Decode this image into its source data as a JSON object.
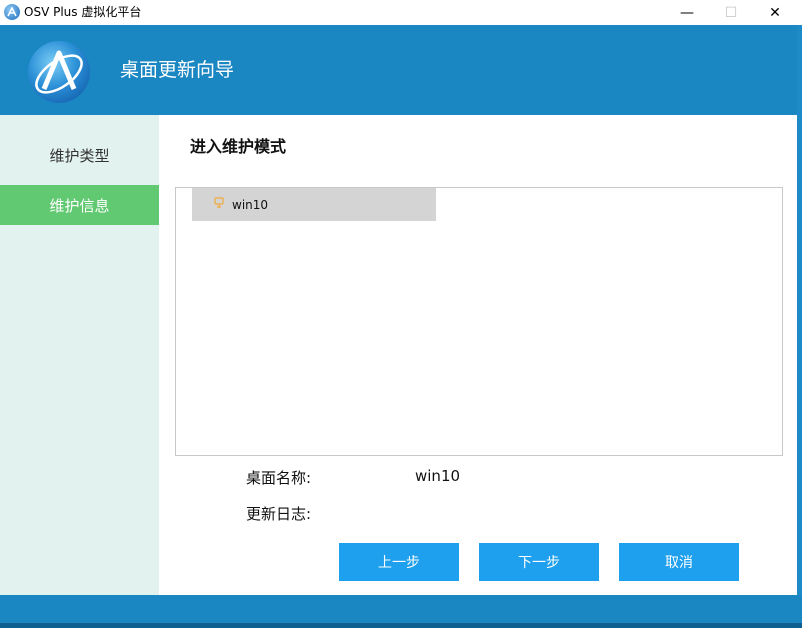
{
  "window": {
    "title": "OSV Plus 虚拟化平台",
    "controls": {
      "minimize": "—",
      "maximize": "☐",
      "close": "✕"
    }
  },
  "header": {
    "title": "桌面更新向导"
  },
  "sidebar": {
    "items": [
      {
        "label": "维护类型",
        "active": false
      },
      {
        "label": "维护信息",
        "active": true
      }
    ]
  },
  "main": {
    "section_title": "进入维护模式",
    "list": {
      "items": [
        {
          "icon": "vm-icon",
          "label": "win10",
          "selected": true
        }
      ]
    },
    "details": {
      "desktop_name_label": "桌面名称:",
      "desktop_name_value": "win10",
      "update_log_label": "更新日志:"
    },
    "buttons": {
      "prev": "上一步",
      "next": "下一步",
      "cancel": "取消"
    }
  },
  "colors": {
    "header": "#1a86c2",
    "sidebar_bg": "#e2f2ee",
    "sidebar_active": "#62c973",
    "button": "#1fa0ee",
    "selected_row": "#d4d4d4"
  }
}
